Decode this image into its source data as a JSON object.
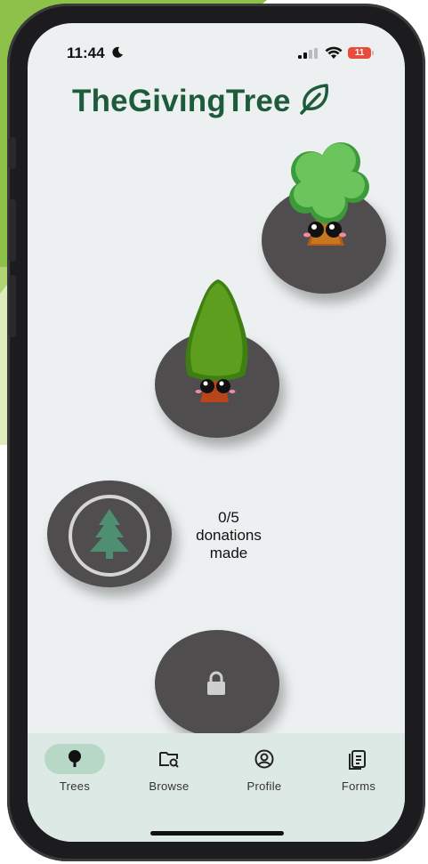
{
  "status": {
    "time": "11:44",
    "battery": "11"
  },
  "app": {
    "title": "TheGivingTree"
  },
  "progress": {
    "text_line1": "0/5",
    "text_line2": "donations",
    "text_line3": "made",
    "completed": 0,
    "total": 5
  },
  "tabs": [
    {
      "label": "Trees",
      "icon": "tree-icon",
      "active": true
    },
    {
      "label": "Browse",
      "icon": "folder-search-icon",
      "active": false
    },
    {
      "label": "Profile",
      "icon": "user-circle-icon",
      "active": false
    },
    {
      "label": "Forms",
      "icon": "document-icon",
      "active": false
    }
  ],
  "colors": {
    "brand": "#1e5b3b",
    "node": "#4f4d4e",
    "background": "#edf0f1",
    "tabbar": "#dde9e5",
    "active_pill": "#b7d7c7",
    "tree_icon": "#4e8f72"
  }
}
